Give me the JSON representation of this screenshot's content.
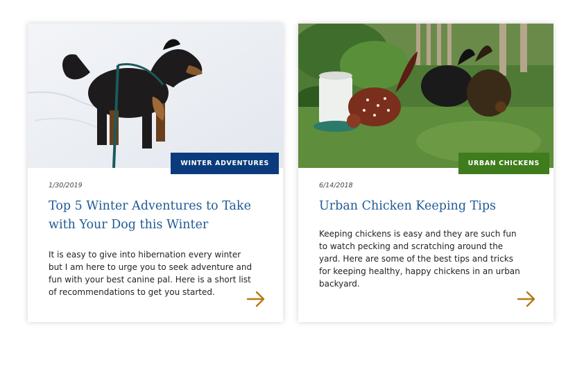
{
  "colors": {
    "title": "#1f5a94",
    "tag_winter": "#0b3b7d",
    "tag_chickens": "#3f7c1c",
    "arrow": "#b37a14"
  },
  "cards": [
    {
      "tag": "WINTER ADVENTURES",
      "date": "1/30/2019",
      "title": "Top 5 Winter Adventures to Take with Your Dog this Winter",
      "excerpt": "It is easy to give into hibernation every winter but I am here to urge you to seek adventure and fun with your best canine pal. Here is a short list of recommendations to get you started.",
      "image": "dog-in-snow-photo",
      "arrow_icon": "arrow-right-icon"
    },
    {
      "tag": "URBAN CHICKENS",
      "date": "6/14/2018",
      "title": "Urban Chicken Keeping Tips",
      "excerpt": "Keeping chickens is easy and they are such fun to watch pecking and scratching around the yard. Here are some of the best tips and tricks for keeping healthy, happy chickens in an urban backyard.",
      "image": "chickens-in-yard-photo",
      "arrow_icon": "arrow-right-icon"
    }
  ]
}
